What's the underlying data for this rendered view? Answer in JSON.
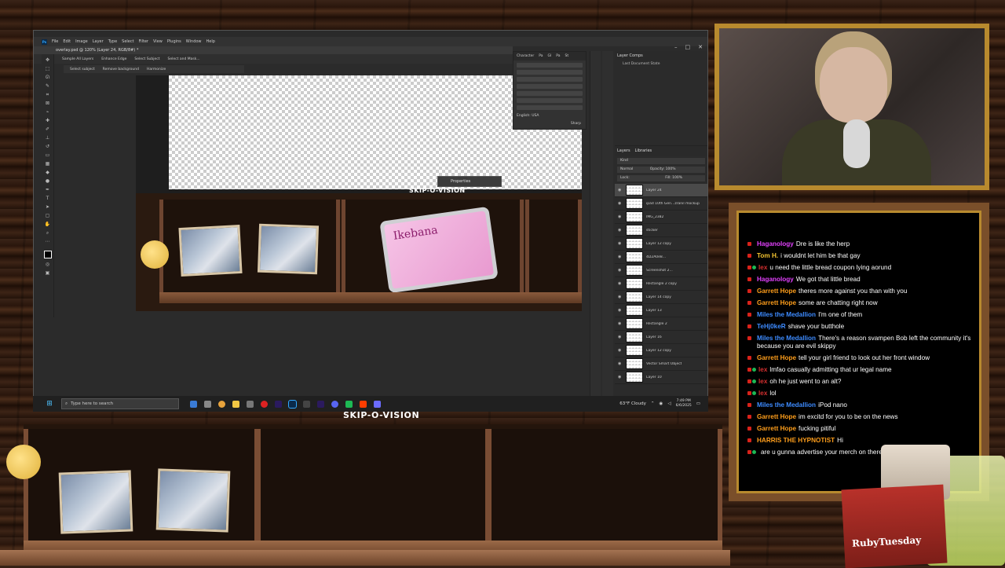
{
  "photoshop": {
    "menu": [
      "File",
      "Edit",
      "Image",
      "Layer",
      "Type",
      "Select",
      "Filter",
      "View",
      "Plugins",
      "Window",
      "Help"
    ],
    "doc_tab": "overlay.psd @ 120% (Layer 24, RGB/8#) *",
    "options": [
      "Sample All Layers",
      "Enhance Edge",
      "Select Subject",
      "Select and Mask..."
    ],
    "options2": [
      "Select subject",
      "Remove background",
      "Harmonize"
    ],
    "panel_tabs": [
      "Character",
      "Pa",
      "Gl",
      "Pa",
      "St"
    ],
    "language": "English: USA",
    "sharp": "Sharp",
    "properties": "Properties",
    "layer_comps_title": "Layer Comps",
    "layer_comps_item": "Last Document State",
    "layers_tabs": [
      "Layers",
      "Libraries"
    ],
    "kind": "Kind",
    "normal": "Normal",
    "opacity": "Opacity: 100%",
    "fill": "Fill: 100%",
    "lock": "Lock:",
    "layers": [
      "Layer 24",
      "ipad 10th Gen...zranil mockup",
      "IMG_2382",
      "sticker",
      "Layer 12 copy",
      "4D2A0e8...",
      "Screenshot 2...",
      "Rectangle 2 copy",
      "Layer 14 copy",
      "Layer 13",
      "Rectangle 2",
      "Layer 16",
      "Layer 12 copy",
      "Vector Smart Object",
      "Layer 10"
    ],
    "canvas_brand": "SKIP-O-VISION",
    "tablet_title": "Ikebana"
  },
  "taskbar": {
    "search_placeholder": "Type here to search",
    "weather": "63°F  Cloudy",
    "time": "7:49 PM",
    "date": "6/6/2025"
  },
  "brand": "SKIP-O-VISION",
  "chat": [
    {
      "user": "Haganology",
      "color": "#e040fb",
      "text": "Dre is like the herp",
      "badge2": false
    },
    {
      "user": "Tom H.",
      "color": "#f4c430",
      "text": "i wouldnt let him be that gay",
      "badge2": false
    },
    {
      "user": "lex",
      "color": "#d32f2f",
      "text": "u need the little bread coupon lying aorund",
      "badge2": true
    },
    {
      "user": "Haganology",
      "color": "#e040fb",
      "text": "We got that little bread",
      "badge2": false
    },
    {
      "user": "Garrett Hope",
      "color": "#ff9e1b",
      "text": "theres more against you than with you",
      "badge2": false
    },
    {
      "user": "Garrett Hope",
      "color": "#ff9e1b",
      "text": "some are chatting right now",
      "badge2": false
    },
    {
      "user": "Miles the Medallion",
      "color": "#3d8bff",
      "text": "I'm one of them",
      "badge2": false
    },
    {
      "user": "TeHj0keR",
      "color": "#3d8bff",
      "text": "shave your butthole",
      "badge2": false
    },
    {
      "user": "Miles the Medallion",
      "color": "#3d8bff",
      "text": "There's a reason svampen Bob left the community it's because you are evil skippy",
      "badge2": false
    },
    {
      "user": "Garrett Hope",
      "color": "#ff9e1b",
      "text": "tell your girl friend to look out her front window",
      "badge2": false
    },
    {
      "user": "lex",
      "color": "#d32f2f",
      "text": "lmfao casually admitting that ur legal name",
      "badge2": true
    },
    {
      "user": "lex",
      "color": "#d32f2f",
      "text": "oh he just went to an alt?",
      "badge2": true
    },
    {
      "user": "lex",
      "color": "#d32f2f",
      "text": "lol",
      "badge2": true
    },
    {
      "user": "Miles the Medallion",
      "color": "#3d8bff",
      "text": "iPod nano",
      "badge2": false
    },
    {
      "user": "Garrett Hope",
      "color": "#ff9e1b",
      "text": "im excitd for you to be on the news",
      "badge2": false
    },
    {
      "user": "Garrett Hope",
      "color": "#ff9e1b",
      "text": "fucking pitiful",
      "badge2": false
    },
    {
      "user": "HARRIS THE HYPNOTIST",
      "color": "#ff9e1b",
      "text": "Hi",
      "badge2": false
    },
    {
      "user": "",
      "color": "#3d3dff",
      "text": "are u gunna advertise your merch on there",
      "badge2": true
    }
  ],
  "ruby": "RubyTuesday"
}
